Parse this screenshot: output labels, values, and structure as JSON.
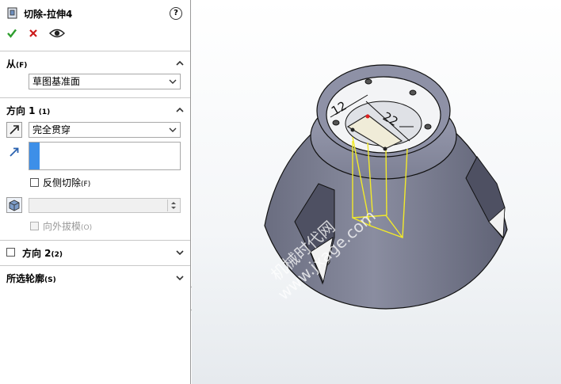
{
  "header": {
    "title": "切除-拉伸4",
    "help_icon": "?"
  },
  "sections": {
    "from": {
      "title": "从",
      "shortcut": "(F)",
      "select_value": "草图基准面"
    },
    "direction1": {
      "title": "方向 1",
      "shortcut": "(1)",
      "end_condition": "完全贯穿",
      "flip_side_label": "反侧切除",
      "flip_side_shortcut": "(F)",
      "draft_outward_label": "向外拔模",
      "draft_outward_shortcut": "(O)"
    },
    "direction2": {
      "title": "方向 2",
      "shortcut": "(2)"
    },
    "contours": {
      "title": "所选轮廓",
      "shortcut": "(S)"
    }
  },
  "viewport": {
    "dim_left": "12",
    "dim_right": "22",
    "watermark_cn": "机械时代网",
    "watermark_en": "www.jxage.com"
  },
  "colors": {
    "accent_check": "#2e9e2e",
    "accent_cancel": "#cc1a1a",
    "selection_blue": "#3d8fe8",
    "sketch_yellow": "#f2ea2a",
    "model_gray": "#7c7f93"
  }
}
